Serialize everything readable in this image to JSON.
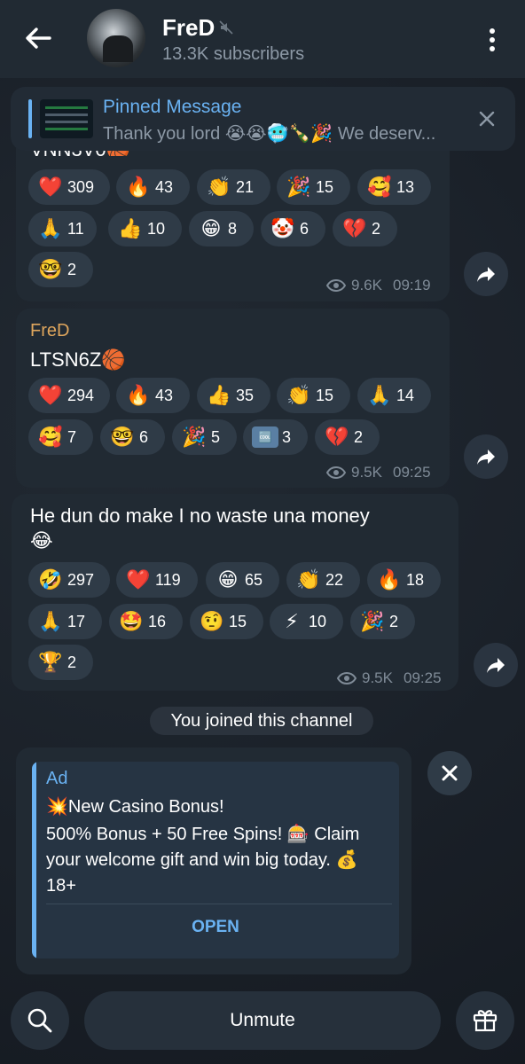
{
  "header": {
    "title": "FreD",
    "subtitle": "13.3K subscribers"
  },
  "pinned": {
    "title": "Pinned Message",
    "text": "Thank you lord 😭😭🥶🍾🎉 We deserv..."
  },
  "messages": [
    {
      "partial_text": "VNN3V0🏀",
      "reactions": [
        {
          "emoji": "❤️",
          "count": "309"
        },
        {
          "emoji": "🔥",
          "count": "43"
        },
        {
          "emoji": "👏",
          "count": "21"
        },
        {
          "emoji": "🎉",
          "count": "15"
        },
        {
          "emoji": "🥰",
          "count": "13"
        },
        {
          "emoji": "🙏",
          "count": "11"
        },
        {
          "emoji": "👍",
          "count": "10"
        },
        {
          "emoji": "😁",
          "count": "8"
        },
        {
          "emoji": "🤡",
          "count": "6"
        },
        {
          "emoji": "💔",
          "count": "2"
        },
        {
          "emoji": "🤓",
          "count": "2"
        }
      ],
      "views": "9.6K",
      "time": "09:19"
    },
    {
      "sender": "FreD",
      "text": "LTSN6Z🏀",
      "reactions": [
        {
          "emoji": "❤️",
          "count": "294"
        },
        {
          "emoji": "🔥",
          "count": "43"
        },
        {
          "emoji": "👍",
          "count": "35"
        },
        {
          "emoji": "👏",
          "count": "15"
        },
        {
          "emoji": "🙏",
          "count": "14"
        },
        {
          "emoji": "🥰",
          "count": "7"
        },
        {
          "emoji": "🤓",
          "count": "6"
        },
        {
          "emoji": "🎉",
          "count": "5"
        },
        {
          "emoji": "🆒",
          "count": "3"
        },
        {
          "emoji": "💔",
          "count": "2"
        }
      ],
      "views": "9.5K",
      "time": "09:25"
    },
    {
      "text": "He dun do make I no waste una money",
      "text2": "😂",
      "reactions": [
        {
          "emoji": "🤣",
          "count": "297"
        },
        {
          "emoji": "❤️",
          "count": "119"
        },
        {
          "emoji": "😁",
          "count": "65"
        },
        {
          "emoji": "👏",
          "count": "22"
        },
        {
          "emoji": "🔥",
          "count": "18"
        },
        {
          "emoji": "🙏",
          "count": "17"
        },
        {
          "emoji": "🤩",
          "count": "16"
        },
        {
          "emoji": "🤨",
          "count": "15"
        },
        {
          "emoji": "⚡",
          "count": "10"
        },
        {
          "emoji": "🎉",
          "count": "2"
        },
        {
          "emoji": "🏆",
          "count": "2"
        }
      ],
      "views": "9.5K",
      "time": "09:25"
    }
  ],
  "system_message": "You joined this channel",
  "ad": {
    "label": "Ad",
    "title": "💥New Casino Bonus!",
    "text": "500% Bonus + 50 Free Spins! 🎰 Claim your welcome gift and win big today. 💰 18+",
    "button": "OPEN"
  },
  "bottom": {
    "unmute_label": "Unmute"
  },
  "colors": {
    "accent": "#6ab2f2",
    "sender": "#dfa65d",
    "bubble": "#212a33",
    "reaction_bg": "#2f3b47"
  }
}
